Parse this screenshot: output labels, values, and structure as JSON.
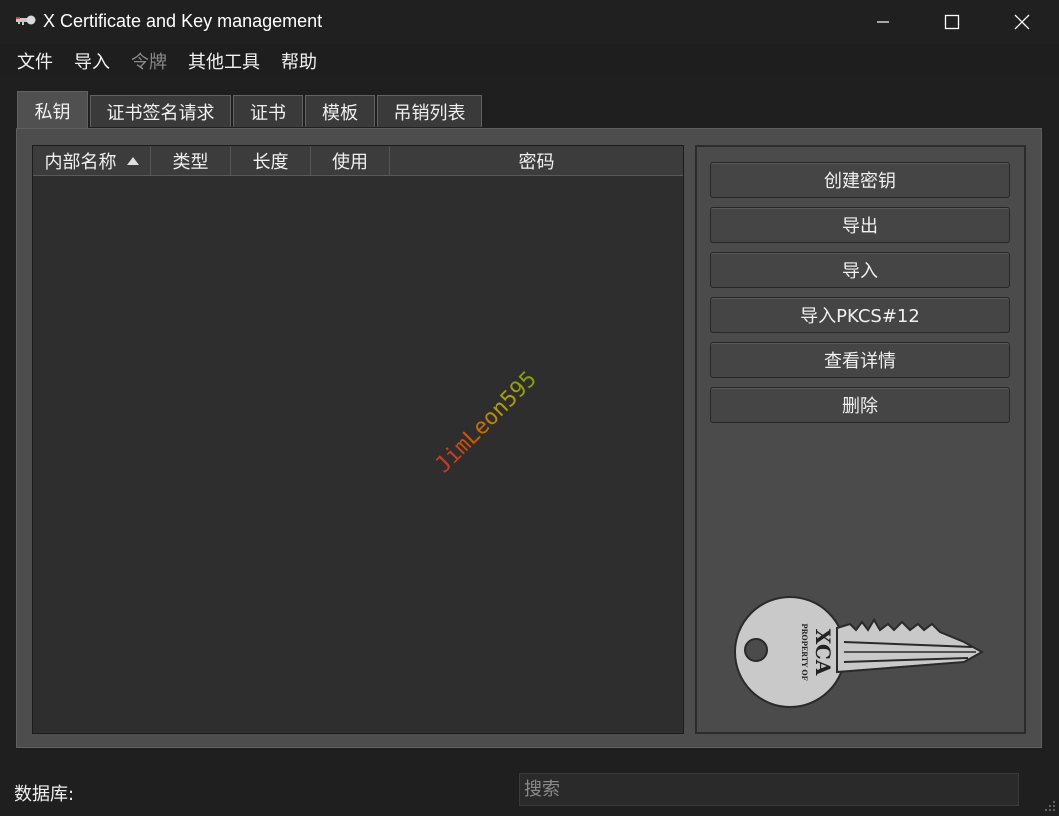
{
  "window": {
    "title": "X Certificate and Key management"
  },
  "menu": {
    "items": [
      {
        "label": "文件",
        "disabled": false
      },
      {
        "label": "导入",
        "disabled": false
      },
      {
        "label": "令牌",
        "disabled": true
      },
      {
        "label": "其他工具",
        "disabled": false
      },
      {
        "label": "帮助",
        "disabled": false
      }
    ]
  },
  "tabs": [
    {
      "label": "私钥",
      "active": true
    },
    {
      "label": "证书签名请求",
      "active": false
    },
    {
      "label": "证书",
      "active": false
    },
    {
      "label": "模板",
      "active": false
    },
    {
      "label": "吊销列表",
      "active": false
    }
  ],
  "table": {
    "columns": [
      "内部名称",
      "类型",
      "长度",
      "使用",
      "密码"
    ],
    "sorted_column": "内部名称",
    "sort_direction": "ascending",
    "rows": []
  },
  "watermark": "JimLeon595",
  "actions": {
    "buttons": [
      "创建密钥",
      "导出",
      "导入",
      "导入PKCS#12",
      "查看详情",
      "删除"
    ]
  },
  "key_image": {
    "text_top": "PROPERTY OF",
    "text_main": "XCA"
  },
  "status": {
    "database_label": "数据库:",
    "search_placeholder": "搜索",
    "search_value": ""
  },
  "colors": {
    "background": "#1f1f1f",
    "panel": "#4d4d4d",
    "table_bg": "#2e2e2e",
    "button_bg": "#454545",
    "text": "#f0f0f0",
    "disabled_text": "#8a8a8a"
  }
}
